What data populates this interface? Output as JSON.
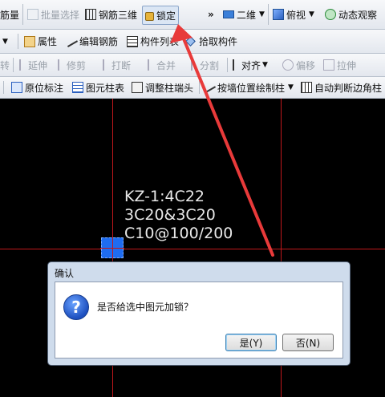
{
  "toolbar1": {
    "quantity_label": "筋量",
    "batch_select_label": "批量选择",
    "rebar_3d_label": "钢筋三维",
    "lock_label": "锁定",
    "overflow_label": "»",
    "view_2d_label": "二维",
    "top_view_label": "俯视",
    "dynamic_observe_label": "动态观察"
  },
  "toolbar2": {
    "properties_label": "属性",
    "edit_rebar_label": "编辑钢筋",
    "component_list_label": "构件列表",
    "pick_component_label": "拾取构件"
  },
  "toolbar3": {
    "rotate_label": "转",
    "extend_label": "延伸",
    "trim_label": "修剪",
    "break_label": "打断",
    "merge_label": "合并",
    "split_label": "分割",
    "align_label": "对齐",
    "offset_label": "偏移",
    "stretch_label": "拉伸"
  },
  "toolbar4": {
    "original_annotation_label": "原位标注",
    "element_column_table_label": "图元柱表",
    "adjust_column_end_label": "调整柱端头",
    "draw_by_wall_label": "按墙位置绘制柱",
    "auto_corner_label": "自动判断边角柱"
  },
  "annotation": {
    "line1": "KZ-1:4C22",
    "line2": "3C20&3C20",
    "line3": "C10@100/200"
  },
  "dialog": {
    "title": "确认",
    "message": "是否给选中图元加锁？",
    "yes_label": "是(Y)",
    "no_label": "否(N)"
  },
  "colors": {
    "axis_line": "#c0181b",
    "column_fill": "#1e6cf0",
    "arrow": "#e83a3a"
  }
}
